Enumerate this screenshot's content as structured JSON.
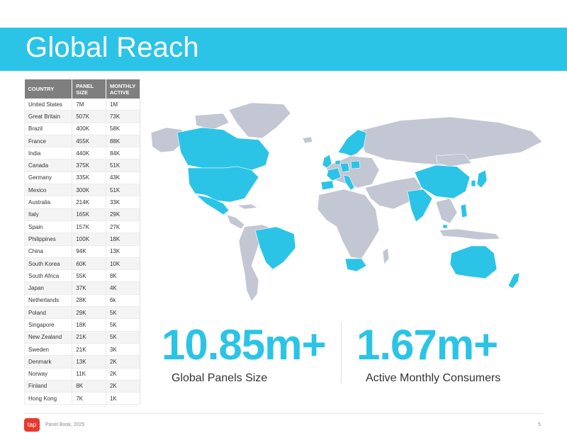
{
  "header": {
    "title": "Global Reach"
  },
  "table": {
    "headers": [
      "COUNTRY",
      "PANEL\nSIZE",
      "MONTHLY\nACTIVE"
    ],
    "rows": [
      [
        "United States",
        "7M",
        "1M"
      ],
      [
        "Great Britain",
        "507K",
        "73K"
      ],
      [
        "Brazil",
        "400K",
        "58K"
      ],
      [
        "France",
        "455K",
        "88K"
      ],
      [
        "India",
        "440K",
        "84K"
      ],
      [
        "Canada",
        "375K",
        "51K"
      ],
      [
        "Germany",
        "335K",
        "43K"
      ],
      [
        "Mexico",
        "300K",
        "51K"
      ],
      [
        "Australia",
        "214K",
        "33K"
      ],
      [
        "Italy",
        "165K",
        "29K"
      ],
      [
        "Spain",
        "157K",
        "27K"
      ],
      [
        "Philippines",
        "100K",
        "18K"
      ],
      [
        "China",
        "94K",
        "13K"
      ],
      [
        "South Korea",
        "60K",
        "10K"
      ],
      [
        "South Africa",
        "55K",
        "8K"
      ],
      [
        "Japan",
        "37K",
        "4K"
      ],
      [
        "Netherlands",
        "28K",
        "6k"
      ],
      [
        "Poland",
        "29K",
        "5K"
      ],
      [
        "Singapore",
        "18K",
        "5K"
      ],
      [
        "New Zealand",
        "21K",
        "5K"
      ],
      [
        "Sweden",
        "21K",
        "3K"
      ],
      [
        "Denmark",
        "13K",
        "2K"
      ],
      [
        "Norway",
        "11K",
        "2K"
      ],
      [
        "Finland",
        "8K",
        "2K"
      ],
      [
        "Hong Kong",
        "7K",
        "1K"
      ]
    ]
  },
  "stats": [
    {
      "value": "10.85m+",
      "label": "Global Panels Size"
    },
    {
      "value": "1.67m+",
      "label": "Active Monthly Consumers"
    }
  ],
  "footer": {
    "logo_text": "tap",
    "document": "Panel Book, 2025",
    "page": "5"
  },
  "colors": {
    "accent": "#2bc4e6",
    "map_base": "#c3c6d3",
    "logo": "#e8392f"
  },
  "map": {
    "highlighted_countries": [
      "United States",
      "Canada",
      "Mexico",
      "Brazil",
      "Great Britain",
      "France",
      "Germany",
      "Italy",
      "Spain",
      "Netherlands",
      "Poland",
      "Sweden",
      "Denmark",
      "Norway",
      "Finland",
      "India",
      "China",
      "Philippines",
      "South Korea",
      "Japan",
      "South Africa",
      "Singapore",
      "Australia",
      "New Zealand",
      "Hong Kong"
    ]
  }
}
